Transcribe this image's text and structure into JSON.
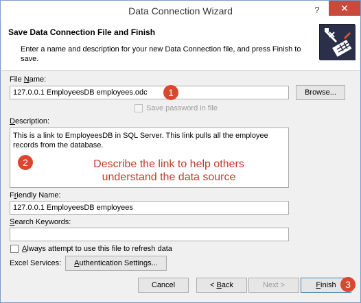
{
  "window": {
    "title": "Data Connection Wizard",
    "help_glyph": "?",
    "close_glyph": "✕"
  },
  "header": {
    "title": "Save Data Connection File and Finish",
    "description": "Enter a name and description for your new Data Connection file, and press Finish to save."
  },
  "file_name": {
    "label_prefix": "File ",
    "label_underlined": "N",
    "label_suffix": "ame:",
    "value": "127.0.0.1 EmployeesDB employees.odc",
    "browse_label": "Browse...",
    "save_password_label": "Save password in file"
  },
  "description": {
    "label_underlined": "D",
    "label_suffix": "escription:",
    "value": "This is a link to EmployeesDB in SQL Server. This link pulls all the employee records from the database."
  },
  "friendly_name": {
    "label_prefix": "F",
    "label_underlined": "r",
    "label_suffix": "iendly Name:",
    "value": "127.0.0.1 EmployeesDB employees"
  },
  "search_keywords": {
    "label_underlined": "S",
    "label_suffix": "earch Keywords:",
    "value": ""
  },
  "always_attempt": {
    "label_underlined": "A",
    "label_suffix": "lways attempt to use this file to refresh data"
  },
  "excel_services": {
    "label": "Excel Services:",
    "auth_underlined": "A",
    "auth_suffix": "uthentication Settings..."
  },
  "buttons": {
    "cancel": "Cancel",
    "back_prefix": "< ",
    "back_underlined": "B",
    "back_suffix": "ack",
    "next": "Next >",
    "finish_underlined": "F",
    "finish_suffix": "inish"
  },
  "annotations": {
    "marker_1": "1",
    "marker_2": "2",
    "marker_3": "3",
    "note_line1": "Describe the link to help others",
    "note_line2": "understand the data source"
  },
  "colors": {
    "annotation": "#c0392b",
    "marker": "#d9472f",
    "close_button": "#c74a3d"
  }
}
